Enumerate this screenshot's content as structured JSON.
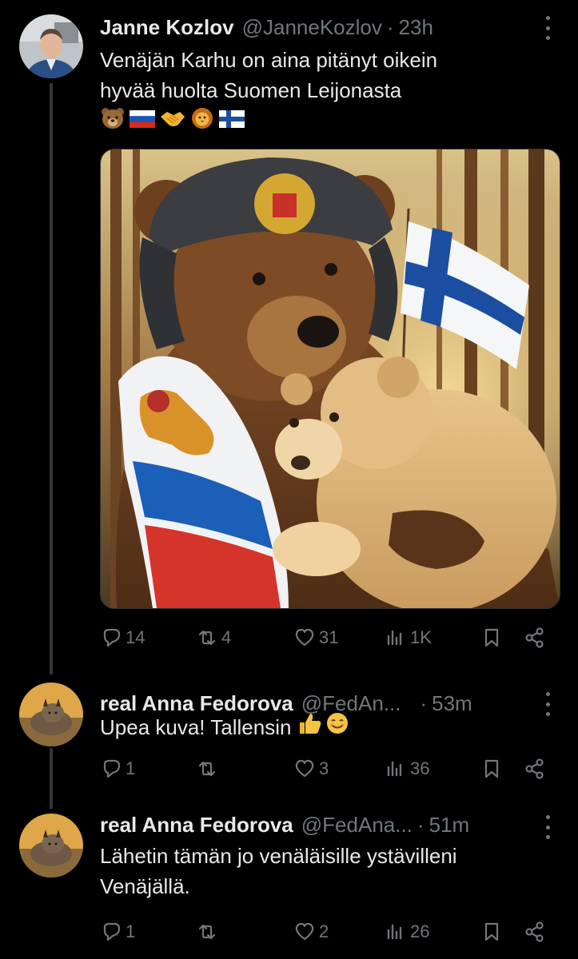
{
  "tweets": [
    {
      "name": "Janne Kozlov",
      "handle": "@JanneKozlov",
      "separator": "·",
      "time": "23h",
      "text_lines": [
        "Venäjän Karhu on aina pitänyt oikein",
        "hyvää huolta Suomen Leijonasta"
      ],
      "emojis": [
        "bear",
        "russia-flag",
        "handshake",
        "lion",
        "finland-flag"
      ],
      "stats": {
        "replies": "14",
        "reposts": "4",
        "likes": "31",
        "views": "1K"
      }
    },
    {
      "name": "real Anna Fedorova",
      "handle": "@FedAn...",
      "separator": "·",
      "time": "53m",
      "text": "Upea kuva! Tallensin",
      "emojis": [
        "thumbs-up",
        "smile"
      ],
      "stats": {
        "replies": "1",
        "reposts": "",
        "likes": "3",
        "views": "36"
      }
    },
    {
      "name": "real Anna Fedorova",
      "handle": "@FedAna...",
      "separator": "·",
      "time": "51m",
      "text_lines": [
        "Lähetin tämän jo venäläisille ystävilleni",
        "Venäjällä."
      ],
      "stats": {
        "replies": "1",
        "reposts": "",
        "likes": "2",
        "views": "26"
      }
    }
  ],
  "colors": {
    "background": "#000000",
    "text": "#e7e9ea",
    "muted": "#71767b",
    "thread_line": "#333639"
  }
}
